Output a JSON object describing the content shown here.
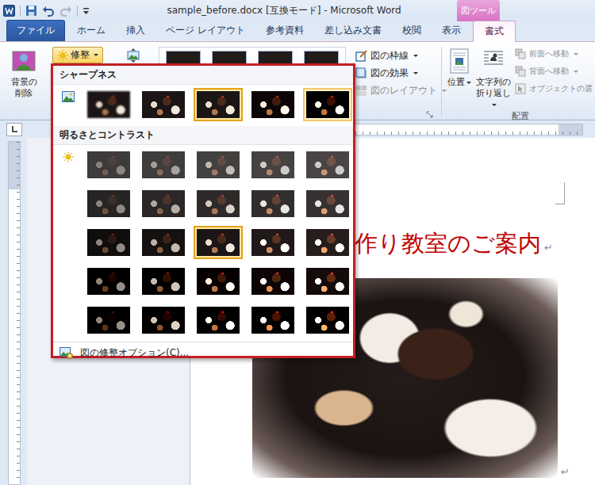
{
  "window": {
    "title": "sample_before.docx [互換モード] - Microsoft Word"
  },
  "contextual_header": {
    "label": "図ツール"
  },
  "tabs": [
    {
      "label": "ファイル",
      "kind": "file",
      "selected": false
    },
    {
      "label": "ホーム",
      "kind": "tab",
      "selected": false
    },
    {
      "label": "挿入",
      "kind": "tab",
      "selected": false
    },
    {
      "label": "ページ レイアウト",
      "kind": "tab",
      "selected": false
    },
    {
      "label": "参考資料",
      "kind": "tab",
      "selected": false
    },
    {
      "label": "差し込み文書",
      "kind": "tab",
      "selected": false
    },
    {
      "label": "校閲",
      "kind": "tab",
      "selected": false
    },
    {
      "label": "表示",
      "kind": "tab",
      "selected": false
    },
    {
      "label": "書式",
      "kind": "contextual",
      "selected": true
    }
  ],
  "ribbon": {
    "remove_background": {
      "label": "背景の削除"
    },
    "corrections": {
      "label": "修整",
      "pressed": true
    },
    "picture_commands": [
      {
        "label": "図の枠線",
        "disabled": false
      },
      {
        "label": "図の効果",
        "disabled": false
      },
      {
        "label": "図のレイアウト",
        "disabled": true
      }
    ],
    "position": {
      "label": "位置"
    },
    "wrap_text": {
      "label": "文字列の折り返し"
    },
    "arrange_commands": [
      {
        "label": "前面へ移動",
        "disabled": true
      },
      {
        "label": "背面へ移動",
        "disabled": true
      },
      {
        "label": "オブジェクトの選",
        "disabled": true
      }
    ],
    "arrange_label": "配置"
  },
  "document": {
    "heading": "作り教室のご案内",
    "paragraph_mark": "↵"
  },
  "corrections_menu": {
    "sections": [
      {
        "title": "シャープネス",
        "kind": "sharpness",
        "rows": [
          [
            {
              "selected": false,
              "hovered": false
            },
            {
              "selected": false,
              "hovered": false
            },
            {
              "selected": true,
              "hovered": false
            },
            {
              "selected": false,
              "hovered": false
            },
            {
              "selected": false,
              "hovered": true
            }
          ]
        ]
      },
      {
        "title": "明るさとコントラスト",
        "kind": "brightness",
        "rows": [
          [
            {
              "selected": false,
              "hovered": false
            },
            {
              "selected": false,
              "hovered": false
            },
            {
              "selected": false,
              "hovered": false
            },
            {
              "selected": false,
              "hovered": false
            },
            {
              "selected": false,
              "hovered": false
            }
          ],
          [
            {
              "selected": false,
              "hovered": false
            },
            {
              "selected": false,
              "hovered": false
            },
            {
              "selected": false,
              "hovered": false
            },
            {
              "selected": false,
              "hovered": false
            },
            {
              "selected": false,
              "hovered": false
            }
          ],
          [
            {
              "selected": false,
              "hovered": false
            },
            {
              "selected": false,
              "hovered": false
            },
            {
              "selected": true,
              "hovered": false
            },
            {
              "selected": false,
              "hovered": false
            },
            {
              "selected": false,
              "hovered": false
            }
          ],
          [
            {
              "selected": false,
              "hovered": false
            },
            {
              "selected": false,
              "hovered": false
            },
            {
              "selected": false,
              "hovered": false
            },
            {
              "selected": false,
              "hovered": false
            },
            {
              "selected": false,
              "hovered": false
            }
          ],
          [
            {
              "selected": false,
              "hovered": false
            },
            {
              "selected": false,
              "hovered": false
            },
            {
              "selected": false,
              "hovered": false
            },
            {
              "selected": false,
              "hovered": false
            },
            {
              "selected": false,
              "hovered": false
            }
          ]
        ]
      }
    ],
    "footer": "図の修整オプション(C)..."
  }
}
